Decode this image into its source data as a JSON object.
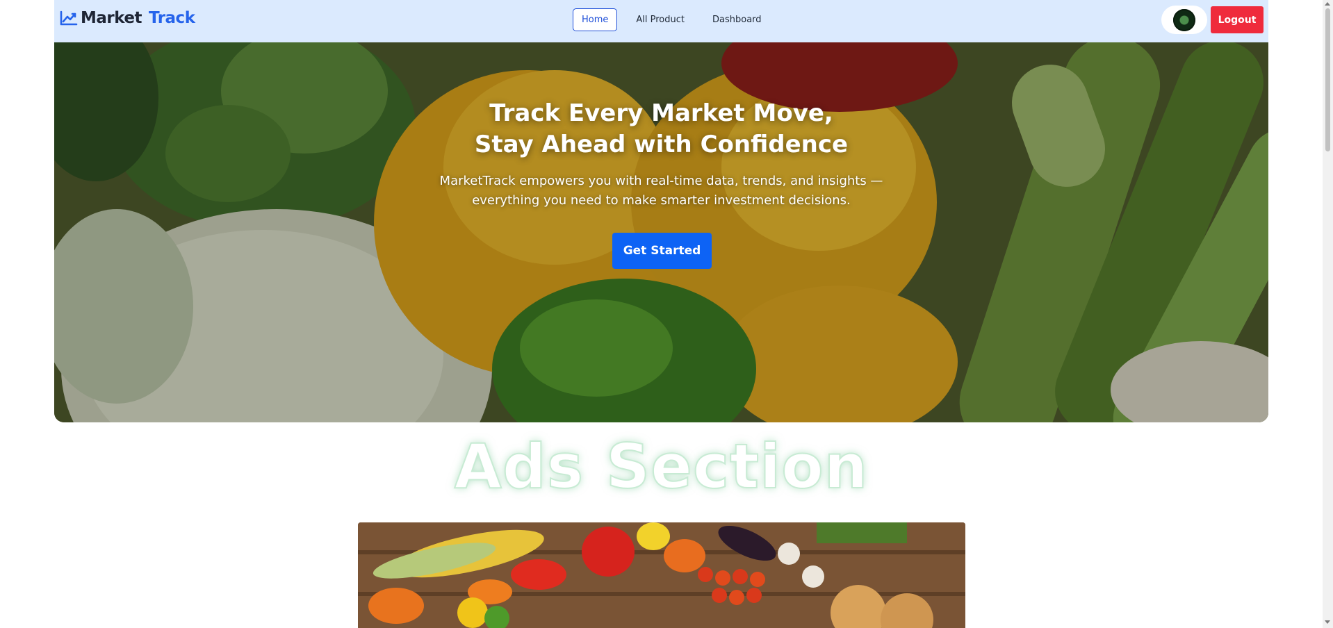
{
  "navbar": {
    "brand_part1": "Market",
    "brand_part2": "Track",
    "brand_icon": "chart-line-icon",
    "links": [
      {
        "label": "Home",
        "active": true
      },
      {
        "label": "All Product",
        "active": false
      },
      {
        "label": "Dashboard",
        "active": false
      }
    ],
    "logout_label": "Logout"
  },
  "hero": {
    "title_line1": "Track Every Market Move,",
    "title_line2": "Stay Ahead with Confidence",
    "subtitle_line1": "MarketTrack empowers you with real-time data, trends, and insights —",
    "subtitle_line2": "everything you need to make smarter investment decisions.",
    "cta_label": "Get Started"
  },
  "ads": {
    "title": "Ads Section"
  },
  "colors": {
    "nav_bg": "#dbeafe",
    "brand_accent": "#2563eb",
    "logout": "#ef2b3c",
    "cta": "#0d63f5"
  }
}
